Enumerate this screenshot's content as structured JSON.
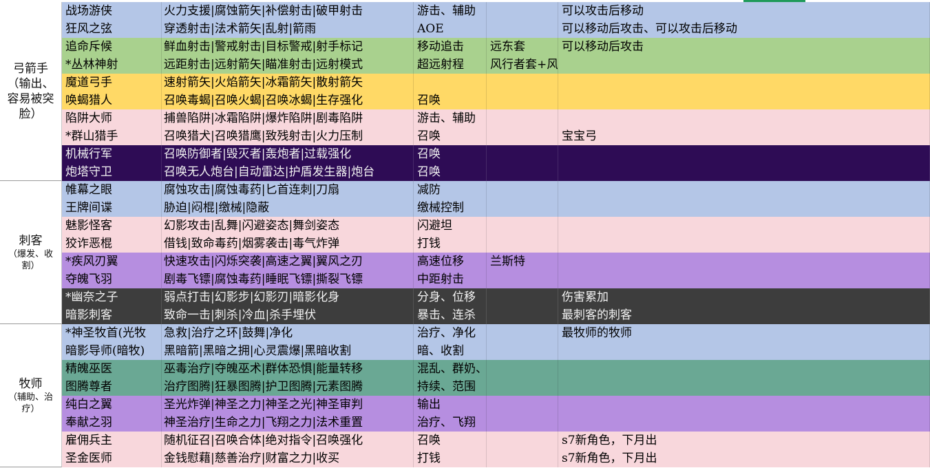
{
  "colors": {
    "blue": "#b4c6e7",
    "green": "#a9d18e",
    "yellow": "#ffd966",
    "pink": "#f8d7dc",
    "indigo": "#2e0c55",
    "purple": "#b68ee0",
    "gray": "#3d3d3d",
    "teal": "#6aa894"
  },
  "categories": [
    {
      "key": "archer",
      "main": "弓箭手",
      "sub": "（输出、容易被突脸）",
      "start": 0,
      "span": 10
    },
    {
      "key": "assassin",
      "main": "刺客",
      "sub": "（爆发、收割）",
      "start": 10,
      "span": 8
    },
    {
      "key": "priest",
      "main": "牧师",
      "sub": "（辅助、治疗）",
      "start": 18,
      "span": 8
    }
  ],
  "rows": [
    {
      "name": "战场游侠",
      "skills": "火力支援|腐蚀箭矢|补偿射击|破甲射击",
      "role": "游击、辅助",
      "set": "",
      "note": "可以攻击后移动",
      "color": "blue"
    },
    {
      "name": "狂风之弦",
      "skills": "穿透射击|法术箭矢|乱射|箭雨",
      "role": "AOE",
      "set": "",
      "note": "可以移动后攻击、可以攻击后移动",
      "color": "blue"
    },
    {
      "name": "追命斥候",
      "skills": "鲜血射击|警戒射击|目标警戒|射手标记",
      "role": "移动追击",
      "set": "远东套",
      "note": "可以移动后攻击",
      "color": "green"
    },
    {
      "name": "*丛林神射",
      "skills": "远距射击|远射箭矢|瞄准射击|远射模式",
      "role": "超远射程",
      "set": "风行者套+风暴宝印",
      "note": "",
      "color": "green"
    },
    {
      "name": "魔道弓手",
      "skills": "速射箭矢|火焰箭矢|冰霜箭矢|散射箭矢",
      "role": "",
      "set": "",
      "note": "",
      "color": "yellow"
    },
    {
      "name": "唤蝎猎人",
      "skills": "召唤毒蝎|召唤火蝎|召唤冰蝎|生存强化",
      "role": "召唤",
      "set": "",
      "note": "",
      "color": "yellow"
    },
    {
      "name": "陷阱大师",
      "skills": "捕兽陷阱|冰霜陷阱|爆炸陷阱|剧毒陷阱",
      "role": "游击、辅助",
      "set": "",
      "note": "",
      "color": "pink"
    },
    {
      "name": "*群山猎手",
      "skills": "召唤猎犬|召唤猎鹰|致残射击|火力压制",
      "role": "召唤",
      "set": "",
      "note": "宝宝弓",
      "color": "pink"
    },
    {
      "name": "机械行军",
      "skills": "召唤防御者|毁灭者|轰炮者|过载强化",
      "role": "召唤",
      "set": "",
      "note": "",
      "color": "indigo"
    },
    {
      "name": "炮塔守卫",
      "skills": "召唤无人炮台|自动雷达|护盾发生器|炮台",
      "role": "召唤",
      "set": "",
      "note": "",
      "color": "indigo"
    },
    {
      "name": "帷幕之眼",
      "skills": "腐蚀攻击|腐蚀毒药|匕首连刺|刀扇",
      "role": "减防",
      "set": "",
      "note": "",
      "color": "blue"
    },
    {
      "name": "王牌间谍",
      "skills": "胁迫|闷棍|缴械|隐蔽",
      "role": "缴械控制",
      "set": "",
      "note": "",
      "color": "blue"
    },
    {
      "name": "魅影怪客",
      "skills": "幻影攻击|乱舞|闪避姿态|舞剑姿态",
      "role": "闪避坦",
      "set": "",
      "note": "",
      "color": "pink"
    },
    {
      "name": "狡诈恶棍",
      "skills": "借钱|致命毒药|烟雾袭击|毒气炸弹",
      "role": "打钱",
      "set": "",
      "note": "",
      "color": "pink"
    },
    {
      "name": "*疾风刃翼",
      "skills": "快速攻击|闪烁突袭|高速之翼|翼风之刃",
      "role": "高速位移",
      "set": "兰斯特",
      "note": "",
      "color": "purple"
    },
    {
      "name": "夺魄飞羽",
      "skills": "剧毒飞镖|腐蚀毒药|睡眠飞镖|撕裂飞镖",
      "role": "中距射击",
      "set": "",
      "note": "",
      "color": "purple"
    },
    {
      "name": "*幽奈之子",
      "skills": "弱点打击|幻影步|幻影刃|暗影化身",
      "role": "分身、位移",
      "set": "",
      "note": "伤害累加",
      "color": "gray"
    },
    {
      "name": "暗影刺客",
      "skills": "致命一击|刺杀|冷血|杀手埋伏",
      "role": "暴击、连杀",
      "set": "",
      "note": "最刺客的刺客",
      "color": "gray"
    },
    {
      "name": "*神圣牧首(光牧",
      "skills": "急救|治疗之环|鼓舞|净化",
      "role": "治疗、净化",
      "set": "",
      "note": "最牧师的牧师",
      "color": "blue"
    },
    {
      "name": "暗影导师(暗牧)",
      "skills": "黑暗箭|黑暗之拥|心灵震爆|黑暗收割",
      "role": "暗、收割",
      "set": "",
      "note": "",
      "color": "blue"
    },
    {
      "name": "精魄巫医",
      "skills": "巫毒治疗|夺魄巫术|群体恐惧|能量转移",
      "role": "混乱、群奶、能量",
      "set": "",
      "note": "",
      "color": "teal"
    },
    {
      "name": "图腾尊者",
      "skills": "治疗图腾|狂暴图腾|护卫图腾|元素图腾",
      "role": "持续、范围",
      "set": "",
      "note": "",
      "color": "teal"
    },
    {
      "name": "纯白之翼",
      "skills": "圣光炸弹|神圣之力|神圣之光|神圣审判",
      "role": "输出",
      "set": "",
      "note": "",
      "color": "purple"
    },
    {
      "name": "奉献之羽",
      "skills": "神圣治疗|生命之力|飞翔之力|法术重置",
      "role": "治疗、飞翔",
      "set": "",
      "note": "",
      "color": "purple"
    },
    {
      "name": "雇佣兵主",
      "skills": "随机征召|召唤合体|绝对指令|召唤强化",
      "role": "召唤",
      "set": "",
      "note": "s7新角色，下月出",
      "color": "pink"
    },
    {
      "name": "圣金医师",
      "skills": "金钱慰藉|慈善治疗|财富之力|收买",
      "role": "打钱",
      "set": "",
      "note": "s7新角色，下月出",
      "color": "pink"
    }
  ]
}
